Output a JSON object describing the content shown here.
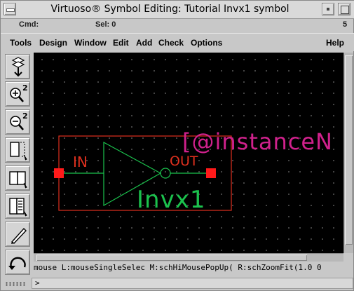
{
  "window": {
    "title": "Virtuoso® Symbol Editing: Tutorial Invx1 symbol"
  },
  "status": {
    "cmd_label": "Cmd:",
    "sel_label": "Sel: 0",
    "count": "5"
  },
  "menu": {
    "items": [
      "Tools",
      "Design",
      "Window",
      "Edit",
      "Add",
      "Check",
      "Options"
    ],
    "help": "Help"
  },
  "toolbar": {
    "tools": [
      {
        "icon": "save-icon"
      },
      {
        "icon": "zoom-in-icon",
        "superscript": "2"
      },
      {
        "icon": "zoom-out-icon",
        "superscript": "2"
      },
      {
        "icon": "stretch-icon"
      },
      {
        "icon": "copy-icon"
      },
      {
        "icon": "property-icon"
      },
      {
        "icon": "pencil-icon"
      },
      {
        "icon": "undo-icon"
      }
    ]
  },
  "canvas": {
    "pin_in_label": "IN",
    "pin_out_label": "OUT",
    "cell_name": "Invx1",
    "instance_label": "[@instanceN",
    "colors": {
      "background": "#000000",
      "outline": "#e0301e",
      "device": "#1bc24d",
      "pin": "#ff1a1a",
      "instance": "#d0218c"
    }
  },
  "mouse_bindings": "mouse L:mouseSingleSelec M:schHiMousePopUp( R:schZoomFit(1.0 0",
  "command_line": {
    "prompt": ">"
  }
}
